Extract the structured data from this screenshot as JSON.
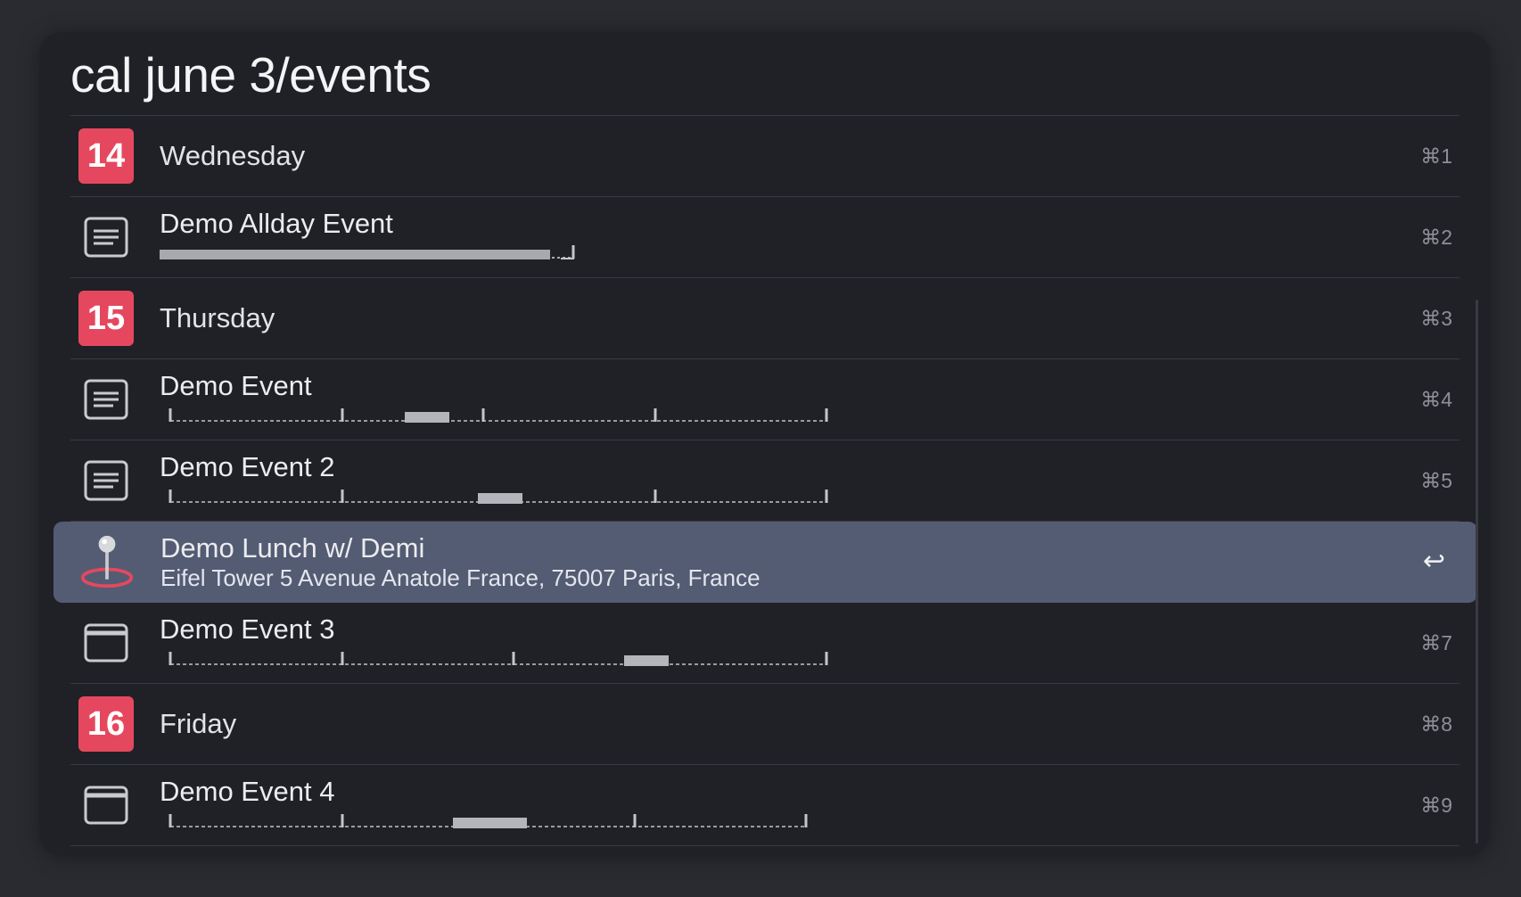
{
  "title": "cal june 3/events",
  "rows": [
    {
      "kind": "day",
      "badge": "14",
      "label": "Wednesday",
      "shortcut": "⌘1"
    },
    {
      "kind": "event",
      "icon": "note-icon",
      "label": "Demo Allday Event",
      "shortcut": "⌘2"
    },
    {
      "kind": "day",
      "badge": "15",
      "label": "Thursday",
      "shortcut": "⌘3"
    },
    {
      "kind": "event",
      "icon": "note-icon",
      "label": "Demo Event",
      "shortcut": "⌘4"
    },
    {
      "kind": "event",
      "icon": "note-icon",
      "label": "Demo Event 2",
      "shortcut": "⌘5"
    },
    {
      "kind": "selected",
      "icon": "map-pin-icon",
      "label": "Demo Lunch w/ Demi",
      "subtitle": "Eifel Tower 5 Avenue Anatole France, 75007 Paris, France",
      "shortcut": "↩"
    },
    {
      "kind": "event",
      "icon": "window-icon",
      "label": "Demo Event 3",
      "shortcut": "⌘7"
    },
    {
      "kind": "day",
      "badge": "16",
      "label": "Friday",
      "shortcut": "⌘8"
    },
    {
      "kind": "event",
      "icon": "window-icon",
      "label": "Demo Event 4",
      "shortcut": "⌘9"
    }
  ],
  "colors": {
    "background": "#2a2b31",
    "panel": "#202127",
    "badge": "#e5485e",
    "selected_row": "#535c73",
    "shortcut_text": "#8e8f96"
  }
}
